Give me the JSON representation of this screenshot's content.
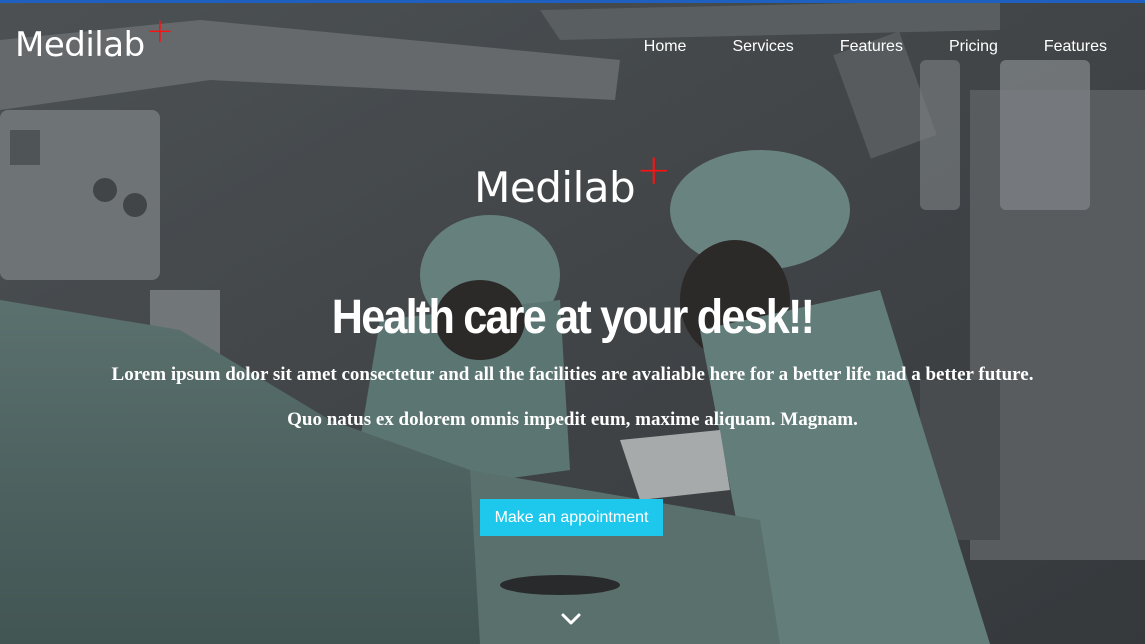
{
  "brand": {
    "name": "Medilab",
    "plus": "+"
  },
  "nav": {
    "items": [
      "Home",
      "Services",
      "Features",
      "Pricing",
      "Features"
    ]
  },
  "hero": {
    "logo_name": "Medilab",
    "logo_plus": "+",
    "headline": "Health care at your desk!!",
    "subtitle": "Lorem ipsum dolor sit amet consectetur and all the facilities are avaliable here for a better life nad a better future.",
    "subtitle2": "Quo natus ex dolorem omnis impedit eum, maxime aliquam. Magnam.",
    "cta_label": "Make an appointment",
    "scroll_icon": "chevron-down-icon"
  },
  "colors": {
    "accent": "#1ec8ec",
    "plus_red": "#ff1111",
    "top_strip": "#1f5fbf"
  }
}
